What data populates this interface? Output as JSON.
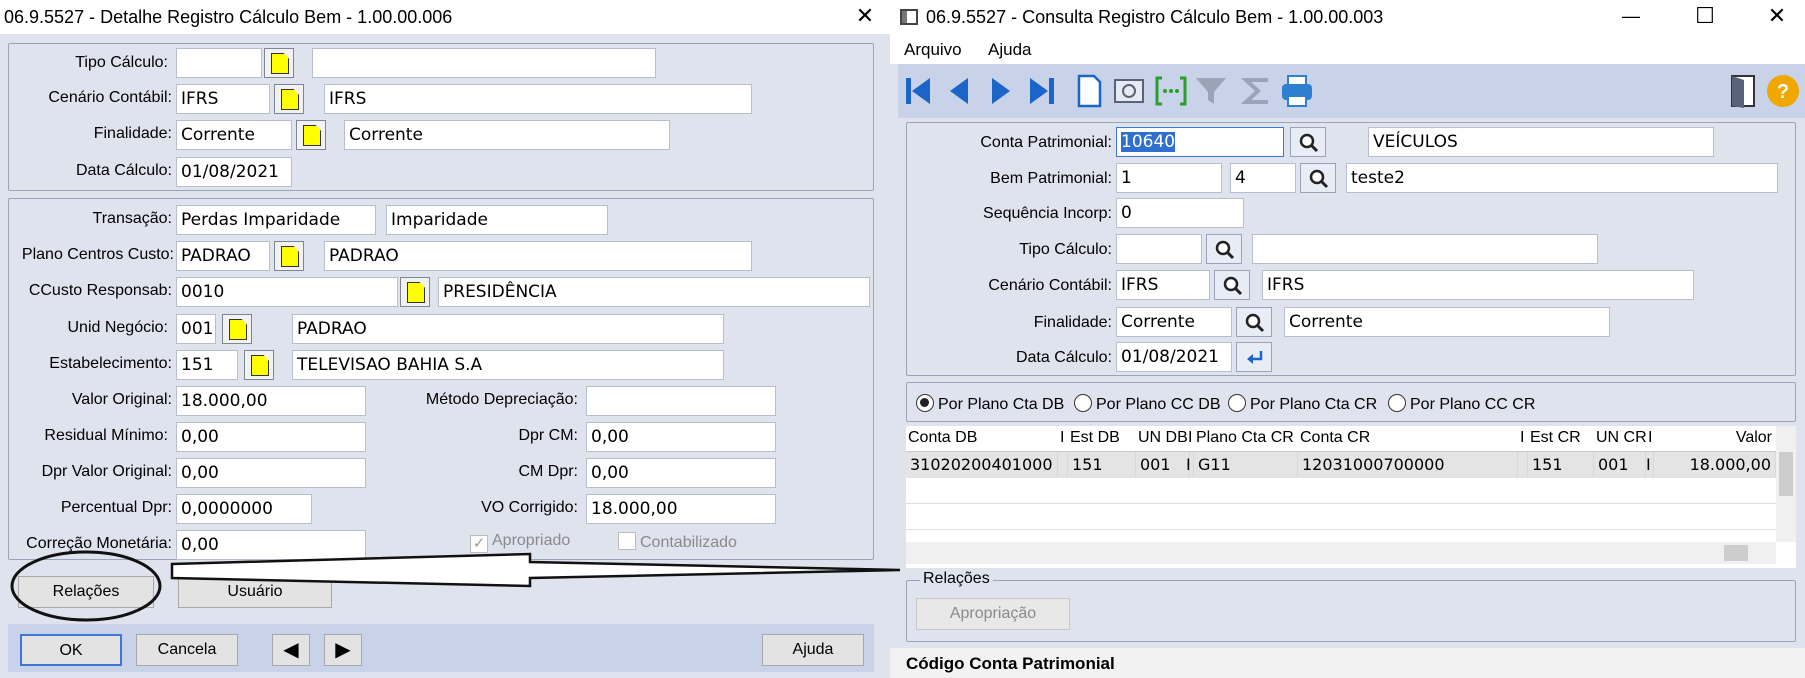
{
  "left": {
    "title": "06.9.5527 - Detalhe Registro Cálculo Bem - 1.00.00.006",
    "close": "✕",
    "group1": {
      "tipo_calculo": {
        "label": "Tipo Cálculo:",
        "code": "",
        "desc": ""
      },
      "cenario": {
        "label": "Cenário Contábil:",
        "code": "IFRS",
        "desc": "IFRS"
      },
      "finalidade": {
        "label": "Finalidade:",
        "code": "Corrente",
        "desc": "Corrente"
      },
      "data_calculo": {
        "label": "Data Cálculo:",
        "value": "01/08/2021"
      }
    },
    "group2": {
      "transacao": {
        "label": "Transação:",
        "code": "Perdas Imparidade",
        "desc": "Imparidade"
      },
      "plano_cc": {
        "label": "Plano Centros Custo:",
        "code": "PADRAO",
        "desc": "PADRAO"
      },
      "ccusto": {
        "label": "CCusto Responsab:",
        "code": "0010",
        "desc": "PRESIDÊNCIA"
      },
      "unid": {
        "label": "Unid Negócio:",
        "code": "001",
        "desc": "PADRAO"
      },
      "estab": {
        "label": "Estabelecimento:",
        "code": "151",
        "desc": "TELEVISAO BAHIA S.A"
      },
      "valor_original": {
        "label": "Valor Original:",
        "value": "18.000,00"
      },
      "residual": {
        "label": "Residual Mínimo:",
        "value": "0,00"
      },
      "dpr_valor": {
        "label": "Dpr Valor Original:",
        "value": "0,00"
      },
      "percentual": {
        "label": "Percentual Dpr:",
        "value": "0,0000000"
      },
      "correcao": {
        "label": "Correção Monetária:",
        "value": "0,00"
      },
      "metodo": {
        "label": "Método Depreciação:",
        "value": ""
      },
      "dpr_cm": {
        "label": "Dpr CM:",
        "value": "0,00"
      },
      "cm_dpr": {
        "label": "CM Dpr:",
        "value": "0,00"
      },
      "vo_corrigido": {
        "label": "VO Corrigido:",
        "value": "18.000,00"
      },
      "apropriado": {
        "label": "Apropriado",
        "check": "✓"
      },
      "contabilizado": {
        "label": "Contabilizado"
      }
    },
    "buttons": {
      "relacoes": "Relações",
      "usuario": "Usuário",
      "ok": "OK",
      "cancela": "Cancela",
      "ajuda": "Ajuda",
      "prev": "◀",
      "next": "▶"
    }
  },
  "right": {
    "title": "06.9.5527 - Consulta Registro Cálculo Bem - 1.00.00.003",
    "controls": {
      "min": "—",
      "max": "☐",
      "close": "✕"
    },
    "menu": {
      "arquivo": "Arquivo",
      "ajuda": "Ajuda"
    },
    "form": {
      "conta": {
        "label": "Conta Patrimonial:",
        "code": "10640",
        "desc": "VEÍCULOS"
      },
      "bem": {
        "label": "Bem Patrimonial:",
        "code": "1",
        "seq": "4",
        "desc": "teste2"
      },
      "sequencia": {
        "label": "Sequência Incorp:",
        "value": "0"
      },
      "tipo": {
        "label": "Tipo Cálculo:",
        "code": "",
        "desc": ""
      },
      "cenario": {
        "label": "Cenário Contábil:",
        "code": "IFRS",
        "desc": "IFRS"
      },
      "finalidade": {
        "label": "Finalidade:",
        "code": "Corrente",
        "desc": "Corrente"
      },
      "data": {
        "label": "Data Cálculo:",
        "value": "01/08/2021"
      }
    },
    "radios": [
      "Por Plano Cta DB",
      "Por Plano CC DB",
      "Por Plano Cta CR",
      "Por Plano CC CR"
    ],
    "grid": {
      "headers": [
        "Conta DB",
        "I",
        "Est DB",
        "UN DB",
        "I",
        "Plano Cta CR",
        "Conta CR",
        "I",
        "Est CR",
        "UN CR",
        "I",
        "Valor"
      ],
      "row": [
        "31020200401000",
        "",
        "151",
        "001",
        "I",
        "G11",
        "12031000700000",
        "",
        "151",
        "001",
        "I",
        "18.000,00"
      ]
    },
    "relacoes": {
      "legend": "Relações",
      "apropriacao": "Apropriação"
    },
    "status": "Código Conta Patrimonial",
    "colors": {
      "help": "#f0a800",
      "nav": "#1d64c8",
      "print": "#2f7fd1"
    }
  }
}
